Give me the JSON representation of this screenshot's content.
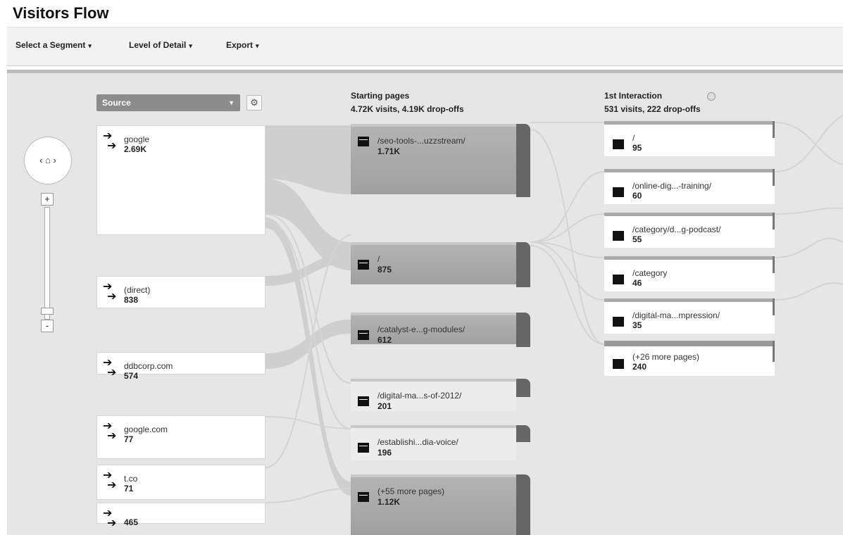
{
  "title": "Visitors Flow",
  "toolbar": {
    "segment_label": "Select a Segment",
    "detail_label": "Level of Detail",
    "export_label": "Export"
  },
  "source_dropdown": {
    "label": "Source"
  },
  "columns": {
    "starting": {
      "title": "Starting pages",
      "stats": "4.72K visits, 4.19K drop-offs"
    },
    "first_interaction": {
      "title": "1st Interaction",
      "stats": "531 visits, 222 drop-offs"
    }
  },
  "sources": [
    {
      "label": "google",
      "value": "2.69K"
    },
    {
      "label": "(direct)",
      "value": "838"
    },
    {
      "label": "ddbcorp.com",
      "value": "574"
    },
    {
      "label": "google.com",
      "value": "77"
    },
    {
      "label": "t.co",
      "value": "71"
    },
    {
      "label": "",
      "value": "465"
    }
  ],
  "starting_pages": [
    {
      "label": "/seo-tools-...uzzstream/",
      "value": "1.71K"
    },
    {
      "label": "/",
      "value": "875"
    },
    {
      "label": "/catalyst-e...g-modules/",
      "value": "612"
    },
    {
      "label": "/digital-ma...s-of-2012/",
      "value": "201"
    },
    {
      "label": "/establishi...dia-voice/",
      "value": "196"
    },
    {
      "label": "(+55 more pages)",
      "value": "1.12K"
    }
  ],
  "interactions": [
    {
      "label": "/",
      "value": "95"
    },
    {
      "label": "/online-dig...-training/",
      "value": "60"
    },
    {
      "label": "/category/d...g-podcast/",
      "value": "55"
    },
    {
      "label": "/category",
      "value": "46"
    },
    {
      "label": "/digital-ma...mpression/",
      "value": "35"
    },
    {
      "label": "(+26 more pages)",
      "value": "240"
    }
  ],
  "controls": {
    "zoom_in": "+",
    "zoom_out": "-",
    "nav": "‹ ⌂ ›",
    "settings_icon": "gear-icon"
  },
  "colors": {
    "flow": "#cfcfcf",
    "node_gray": "#a8a8a8",
    "dropoff": "#666666",
    "toolbar": "#f2f2f2"
  }
}
